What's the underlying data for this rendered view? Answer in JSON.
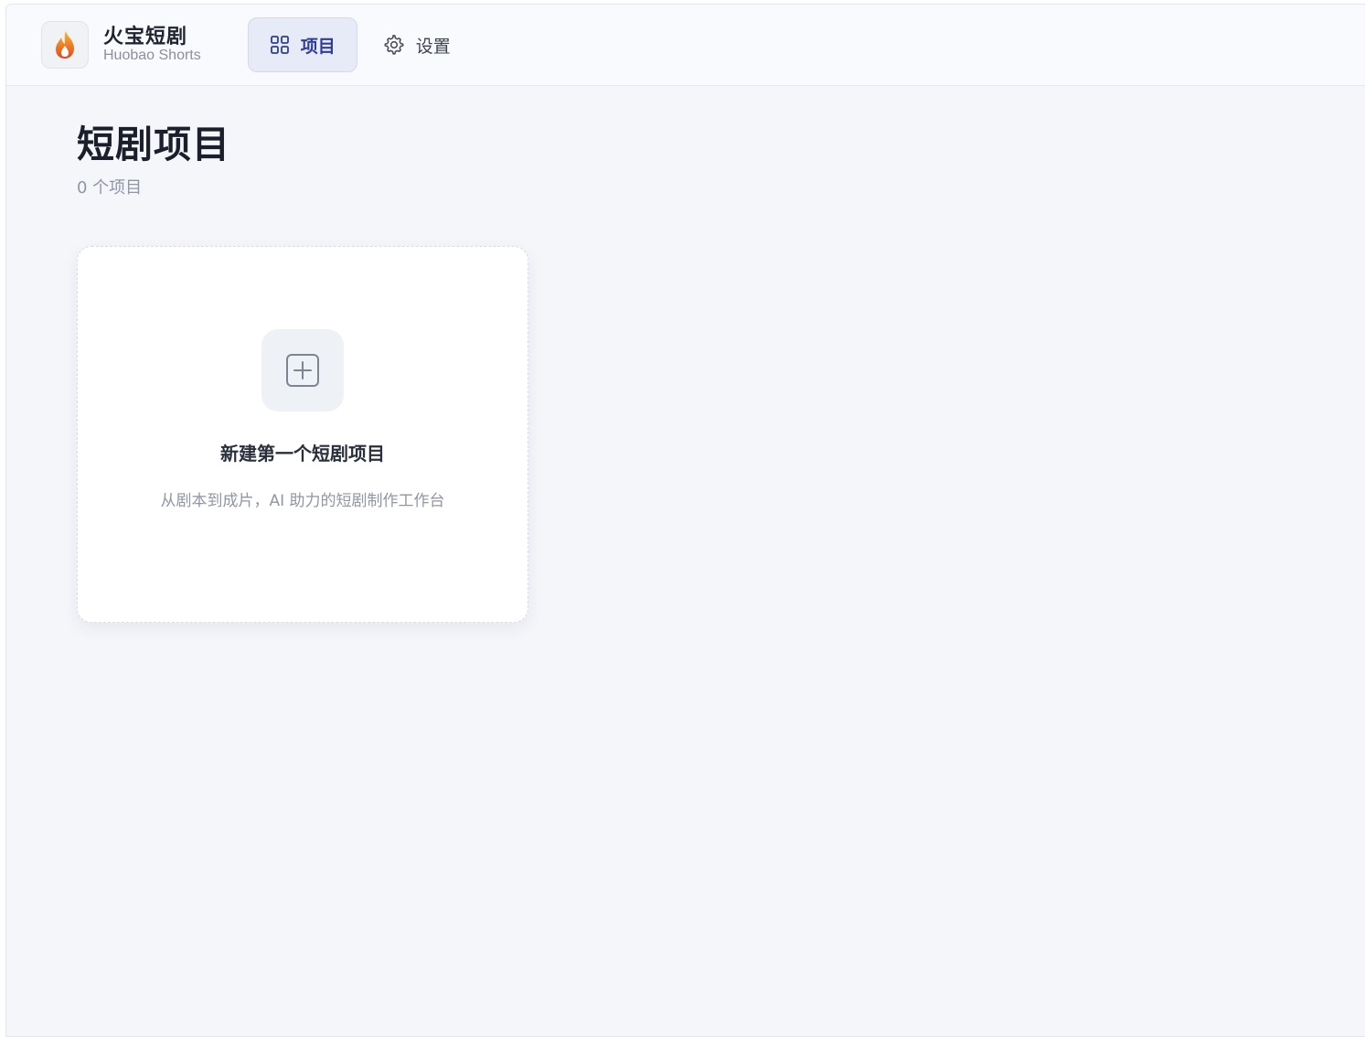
{
  "app": {
    "title": "火宝短剧",
    "subtitle": "Huobao Shorts",
    "logo_icon": "flame-icon"
  },
  "nav": {
    "items": [
      {
        "label": "项目",
        "icon": "grid-icon",
        "active": true
      },
      {
        "label": "设置",
        "icon": "gear-icon",
        "active": false
      }
    ]
  },
  "page": {
    "title": "短剧项目",
    "count_text": "0 个项目"
  },
  "empty_card": {
    "icon": "plus-square-icon",
    "title": "新建第一个短剧项目",
    "description": "从剧本到成片，AI 助力的短剧制作工作台"
  },
  "colors": {
    "accent": "#2e3e9a",
    "nav_active_bg": "#e7ebf8",
    "page_bg": "#f4f6fa",
    "flame_orange": "#f08a1c",
    "flame_red": "#e4481e"
  }
}
